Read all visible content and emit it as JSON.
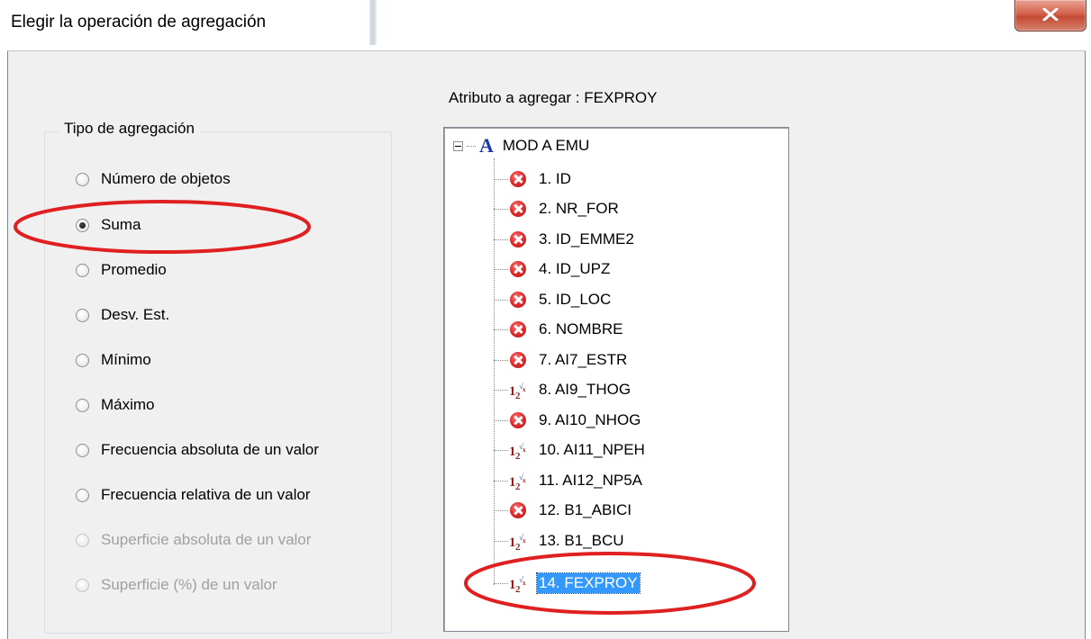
{
  "window": {
    "title": "Elegir la operación de agregación"
  },
  "aggregation": {
    "legend": "Tipo de agregación",
    "selected": "Suma",
    "options": [
      {
        "label": "Número de objetos",
        "checked": false,
        "enabled": true
      },
      {
        "label": "Suma",
        "checked": true,
        "enabled": true
      },
      {
        "label": "Promedio",
        "checked": false,
        "enabled": true
      },
      {
        "label": "Desv. Est.",
        "checked": false,
        "enabled": true
      },
      {
        "label": "Mínimo",
        "checked": false,
        "enabled": true
      },
      {
        "label": "Máximo",
        "checked": false,
        "enabled": true
      },
      {
        "label": "Frecuencia absoluta de un valor",
        "checked": false,
        "enabled": true
      },
      {
        "label": "Frecuencia relativa de un valor",
        "checked": false,
        "enabled": true
      },
      {
        "label": "Superficie absoluta de un valor",
        "checked": false,
        "enabled": false
      },
      {
        "label": "Superficie (%) de un valor",
        "checked": false,
        "enabled": false
      }
    ]
  },
  "attribute": {
    "label": "Atributo a agregar :  FEXPROY",
    "tree": {
      "root": {
        "label": "MOD A EMU",
        "icon": "layer-a-icon",
        "expander": "collapse-icon"
      },
      "items": [
        {
          "label": "1. ID",
          "icon": "error-icon",
          "selected": false
        },
        {
          "label": "2. NR_FOR",
          "icon": "error-icon",
          "selected": false
        },
        {
          "label": "3. ID_EMME2",
          "icon": "error-icon",
          "selected": false
        },
        {
          "label": "4. ID_UPZ",
          "icon": "error-icon",
          "selected": false
        },
        {
          "label": "5. ID_LOC",
          "icon": "error-icon",
          "selected": false
        },
        {
          "label": "6. NOMBRE",
          "icon": "error-icon",
          "selected": false
        },
        {
          "label": "7. AI7_ESTR",
          "icon": "error-icon",
          "selected": false
        },
        {
          "label": "8. AI9_THOG",
          "icon": "numeric-icon",
          "selected": false
        },
        {
          "label": "9. AI10_NHOG",
          "icon": "error-icon",
          "selected": false
        },
        {
          "label": "10. AI11_NPEH",
          "icon": "numeric-icon",
          "selected": false
        },
        {
          "label": "11. AI12_NP5A",
          "icon": "numeric-icon",
          "selected": false
        },
        {
          "label": "12. B1_ABICI",
          "icon": "error-icon",
          "selected": false
        },
        {
          "label": "13. B1_BCU",
          "icon": "numeric-icon",
          "selected": false
        },
        {
          "label": "14. FEXPROY",
          "icon": "numeric-icon",
          "selected": true
        }
      ]
    }
  },
  "colors": {
    "selection": "#3399ff",
    "annotation": "#e02020",
    "error_icon": "#d42b2b",
    "close_button": "#c94a35"
  }
}
